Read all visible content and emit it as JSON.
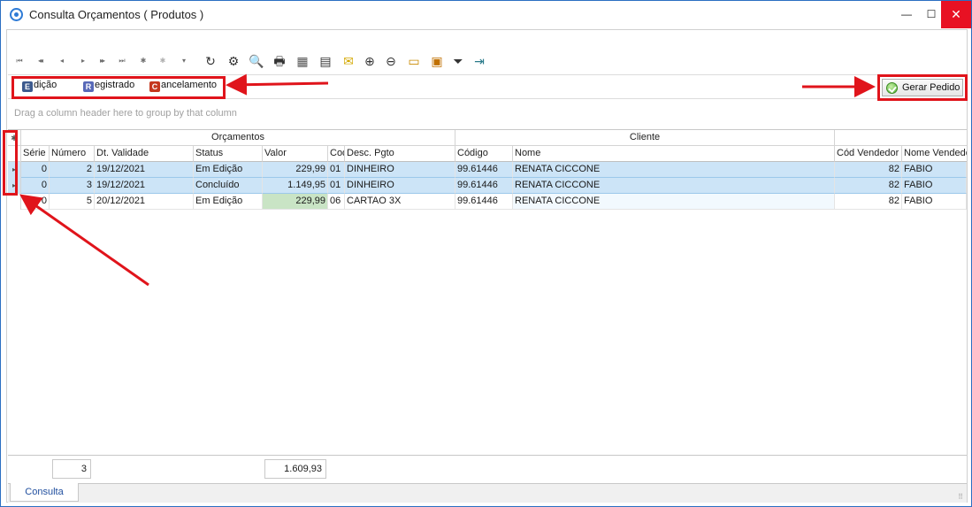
{
  "window": {
    "title": "Consulta Orçamentos ( Produtos )",
    "min_glyph": "—",
    "max_glyph": "☐",
    "close_glyph": "✕"
  },
  "toolbar": {
    "nav_glyphs": [
      "⏮",
      "◂◂",
      "◂",
      "▸",
      "▸▸",
      "⏭",
      "✱",
      "✱",
      "▾"
    ],
    "tool_glyphs": [
      "↻",
      "⚙",
      "🔍",
      "🖶",
      "▦",
      "▤",
      "✉",
      "⊕",
      "⊖",
      "▭",
      "▣",
      "⏷",
      "⇥"
    ]
  },
  "legend": {
    "edicao": {
      "letter": "E",
      "label": "dição"
    },
    "registrado": {
      "letter": "R",
      "label": "egistrado"
    },
    "cancelamento": {
      "letter": "C",
      "label": "ancelamento"
    }
  },
  "gerar_pedido": {
    "label": "Gerar Pedido"
  },
  "group_panel": {
    "hint": "Drag a column header here to group by that column"
  },
  "grid": {
    "indicator_header": "✱",
    "bands": {
      "orcamentos": "Orçamentos",
      "cliente": "Cliente"
    },
    "columns": {
      "serie": "Série",
      "numero": "Número",
      "validade": "Dt. Validade",
      "status": "Status",
      "valor": "Valor",
      "cod_pgto": "Cod",
      "desc_pgto": "Desc. Pgto",
      "codigo": "Código",
      "nome": "Nome",
      "cod_vendedor": "Cód Vendedor",
      "nome_vendedor": "Nome Vendedor"
    },
    "rows": [
      {
        "indicator": "▸",
        "serie": "0",
        "numero": "2",
        "validade": "19/12/2021",
        "status": "Em Edição",
        "valor": "229,99",
        "cod_pgto": "01",
        "desc_pgto": "DINHEIRO",
        "codigo": "99.61446",
        "nome": "RENATA CICCONE",
        "cod_vendedor": "82",
        "nome_vendedor": "FABIO"
      },
      {
        "indicator": "▸",
        "serie": "0",
        "numero": "3",
        "validade": "19/12/2021",
        "status": "Concluído",
        "valor": "1.149,95",
        "cod_pgto": "01",
        "desc_pgto": "DINHEIRO",
        "codigo": "99.61446",
        "nome": "RENATA CICCONE",
        "cod_vendedor": "82",
        "nome_vendedor": "FABIO"
      },
      {
        "indicator": "",
        "serie": "0",
        "numero": "5",
        "validade": "20/12/2021",
        "status": "Em Edição",
        "valor": "229,99",
        "cod_pgto": "06",
        "desc_pgto": "CARTAO 3X",
        "codigo": "99.61446",
        "nome": "RENATA CICCONE",
        "cod_vendedor": "82",
        "nome_vendedor": "FABIO"
      }
    ]
  },
  "summary": {
    "count": "3",
    "total": "1.609,93"
  },
  "tabs": {
    "consulta": "Consulta"
  },
  "colors": {
    "annotation_red": "#e0141b",
    "selection": "#cce4f7",
    "highlight_cell": "#c9e4c5"
  }
}
